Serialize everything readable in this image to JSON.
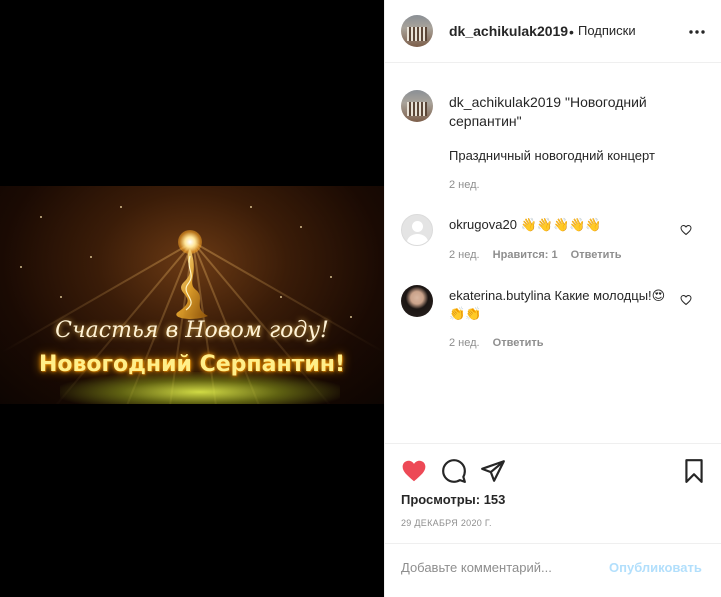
{
  "post": {
    "username": "dk_achikulak2019",
    "separator": "•",
    "follow_label": "Подписки",
    "more_icon": "more-dots-icon",
    "video_text": {
      "line1": "Счастья в Новом году!",
      "line2": "Новогодний Серпантин!"
    }
  },
  "caption": {
    "username": "dk_achikulak2019",
    "text": "\"Новогодний серпантин\"",
    "body": "Праздничный новогодний концерт",
    "time": "2 нед."
  },
  "comments": [
    {
      "username": "okrugova20",
      "text": "👋👋👋👋👋",
      "time": "2 нед.",
      "likes": "Нравится: 1",
      "reply": "Ответить"
    },
    {
      "username": "ekaterina.butylina",
      "text": "Какие молодцы!😍👏👏",
      "time": "2 нед.",
      "reply": "Ответить"
    }
  ],
  "actions": {
    "views": "Просмотры: 153",
    "date": "29 ДЕКАБРЯ 2020 Г.",
    "liked": true,
    "like_color": "#ed4956"
  },
  "comment_box": {
    "placeholder": "Добавьте комментарий...",
    "publish_label": "Опубликовать",
    "publish_color": "#b2dffc"
  }
}
